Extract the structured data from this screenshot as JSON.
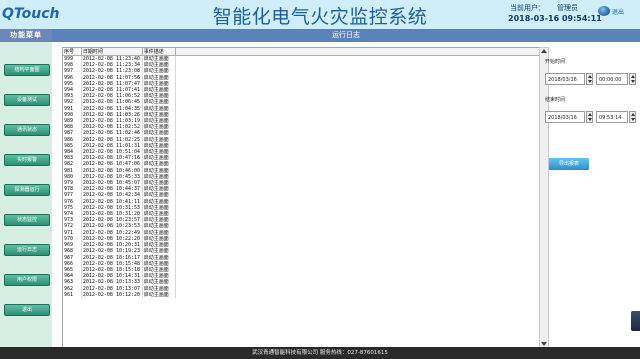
{
  "header": {
    "logo_text": "QTouch",
    "app_title": "智能化电气火灾监控系统",
    "user_label": "当前用户：",
    "user_value": "管理员",
    "datetime": "2018-03-16 09:54:11",
    "logout_label": "退出"
  },
  "sidebar": {
    "title": "功能菜单",
    "items": [
      {
        "label": "结构平面图"
      },
      {
        "label": "设备测试"
      },
      {
        "label": "通讯状态"
      },
      {
        "label": "实时报警"
      },
      {
        "label": "探测器运行"
      },
      {
        "label": "状态监控"
      },
      {
        "label": "运行日志"
      },
      {
        "label": "用户权限"
      },
      {
        "label": "退出"
      }
    ]
  },
  "main": {
    "section_title": "运行日志",
    "columns": [
      "序号",
      "日期时间",
      "事件描述"
    ],
    "rows": [
      [
        "999",
        "2012-02-08 11:23:40",
        "启动主画面"
      ],
      [
        "998",
        "2012-02-08 11:23:34",
        "启动主画面"
      ],
      [
        "997",
        "2012-02-08 11:23:08",
        "启动主画面"
      ],
      [
        "996",
        "2012-02-08 11:07:56",
        "启动主画面"
      ],
      [
        "995",
        "2012-02-08 11:07:47",
        "启动主画面"
      ],
      [
        "994",
        "2012-02-08 11:07:41",
        "启动主画面"
      ],
      [
        "993",
        "2012-02-08 11:06:52",
        "启动主画面"
      ],
      [
        "992",
        "2012-02-08 11:06:45",
        "启动主画面"
      ],
      [
        "991",
        "2012-02-08 11:04:35",
        "启动主画面"
      ],
      [
        "990",
        "2012-02-08 11:03:26",
        "启动主画面"
      ],
      [
        "989",
        "2012-02-08 11:03:19",
        "启动主画面"
      ],
      [
        "988",
        "2012-02-08 11:02:52",
        "启动主画面"
      ],
      [
        "987",
        "2012-02-08 11:02:46",
        "启动主画面"
      ],
      [
        "986",
        "2012-02-08 11:02:25",
        "启动主画面"
      ],
      [
        "985",
        "2012-02-08 11:01:31",
        "启动主画面"
      ],
      [
        "984",
        "2012-02-08 10:51:04",
        "启动主画面"
      ],
      [
        "983",
        "2012-02-08 10:47:16",
        "启动主画面"
      ],
      [
        "982",
        "2012-02-08 10:47:06",
        "启动主画面"
      ],
      [
        "981",
        "2012-02-08 10:46:00",
        "启动主画面"
      ],
      [
        "980",
        "2012-02-08 10:45:33",
        "启动主画面"
      ],
      [
        "979",
        "2012-02-08 10:45:07",
        "启动主画面"
      ],
      [
        "978",
        "2012-02-08 10:44:37",
        "启动主画面"
      ],
      [
        "977",
        "2012-02-08 10:42:34",
        "启动主画面"
      ],
      [
        "976",
        "2012-02-08 10:41:11",
        "启动主画面"
      ],
      [
        "975",
        "2012-02-08 10:31:53",
        "启动主画面"
      ],
      [
        "974",
        "2012-02-08 10:31:20",
        "启动主画面"
      ],
      [
        "973",
        "2012-02-08 10:23:57",
        "启动主画面"
      ],
      [
        "972",
        "2012-02-08 10:23:53",
        "启动主画面"
      ],
      [
        "971",
        "2012-02-08 10:22:49",
        "启动主画面"
      ],
      [
        "970",
        "2012-02-08 10:22:20",
        "启动主画面"
      ],
      [
        "969",
        "2012-02-08 10:20:31",
        "启动主画面"
      ],
      [
        "968",
        "2012-02-08 10:19:23",
        "启动主画面"
      ],
      [
        "967",
        "2012-02-08 10:16:17",
        "启动主画面"
      ],
      [
        "966",
        "2012-02-08 10:15:48",
        "启动主画面"
      ],
      [
        "965",
        "2012-02-08 10:15:18",
        "启动主画面"
      ],
      [
        "964",
        "2012-02-08 10:14:31",
        "启动主画面"
      ],
      [
        "963",
        "2012-02-08 10:13:33",
        "启动主画面"
      ],
      [
        "962",
        "2012-02-08 10:13:07",
        "启动主画面"
      ],
      [
        "961",
        "2012-02-08 10:12:20",
        "启动主画面"
      ]
    ],
    "start_time_label": "开始时间",
    "start_date": "2018/03/16",
    "start_time": "00:00:00",
    "end_time_label": "结束时间",
    "end_date": "2018/03/16",
    "end_time": "09:53:14",
    "export_label": "导出报表"
  },
  "footer": {
    "text": "武汉青通智能科技有限公司  服务热线：027-87601615"
  }
}
